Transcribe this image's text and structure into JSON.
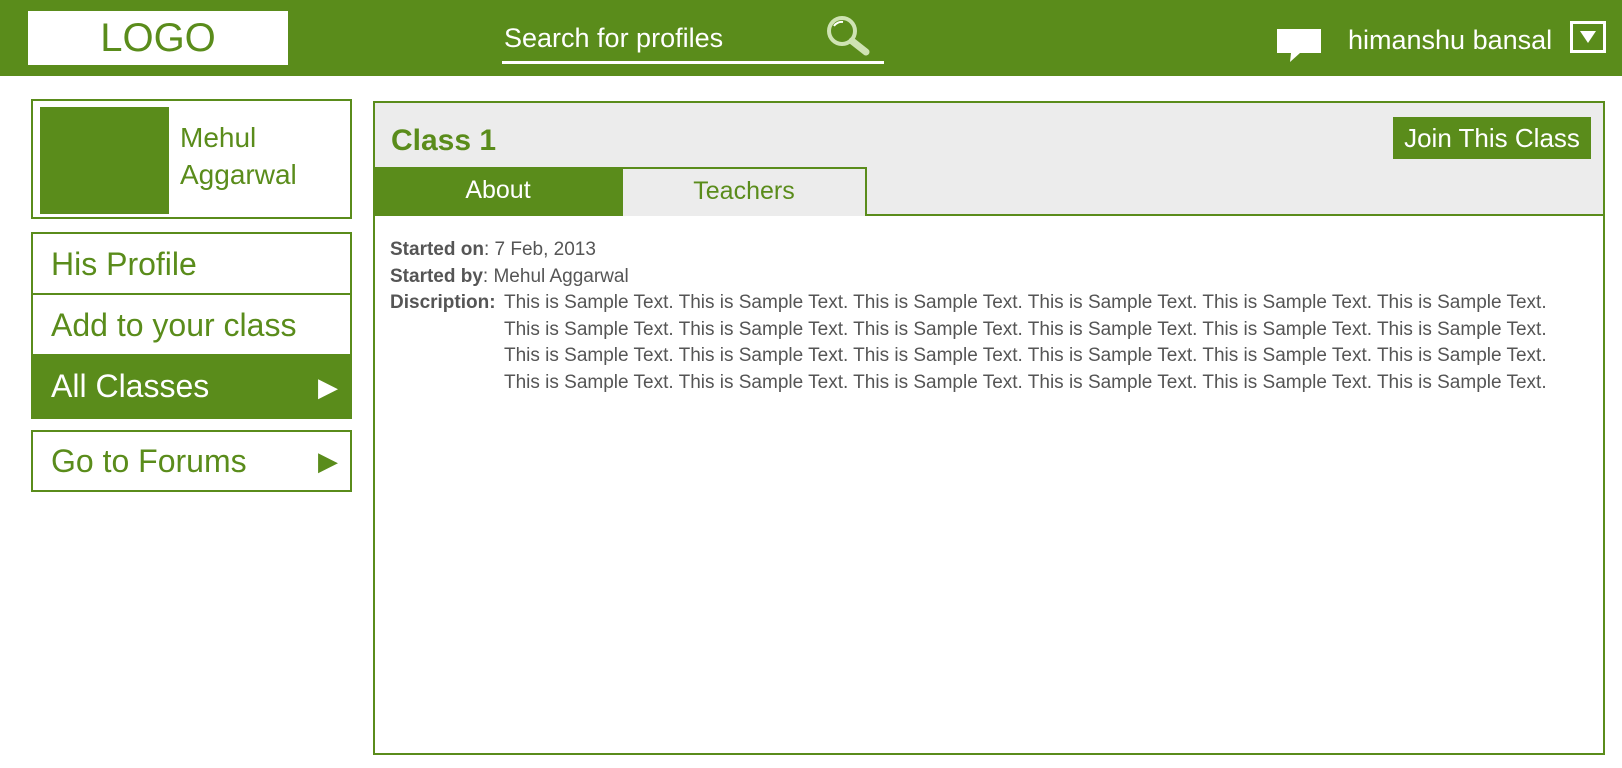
{
  "header": {
    "logo_text": "LOGO",
    "search_placeholder": "Search for profiles",
    "username": "himanshu bansal",
    "icons": [
      "search-icon",
      "chat-icon",
      "chevron-down-icon"
    ],
    "colors": {
      "brand": "#5a8c1b",
      "header_bg": "#ececec",
      "text_gray": "#555555"
    }
  },
  "sidebar": {
    "profile_first_name": "Mehul",
    "profile_last_name": "Aggarwal",
    "menu": [
      {
        "label": "His Profile"
      },
      {
        "label": "Add to your class"
      },
      {
        "label": "All Classes",
        "arrow": "▶"
      }
    ],
    "forums": {
      "label": "Go to Forums",
      "arrow": "▶"
    }
  },
  "main": {
    "title": "Class 1",
    "join_label": "Join This Class",
    "tabs": [
      {
        "label": "About",
        "active": true
      },
      {
        "label": "Teachers",
        "active": false
      }
    ],
    "started_on_label": "Started on",
    "started_on_value": ": 7 Feb, 2013",
    "started_by_label": "Started by",
    "started_by_value": ": Mehul Aggarwal",
    "description_label": "Discription:",
    "description_lines": [
      "This is Sample Text. This is Sample Text. This is Sample Text. This is Sample Text. This is Sample Text. This is Sample Text.",
      "This is Sample Text. This is Sample Text. This is Sample Text. This is Sample Text. This is Sample Text. This is Sample Text.",
      "This is Sample Text. This is Sample Text. This is Sample Text. This is Sample Text. This is Sample Text. This is Sample Text.",
      "This is Sample Text. This is Sample Text. This is Sample Text. This is Sample Text. This is Sample Text. This is Sample Text."
    ]
  }
}
